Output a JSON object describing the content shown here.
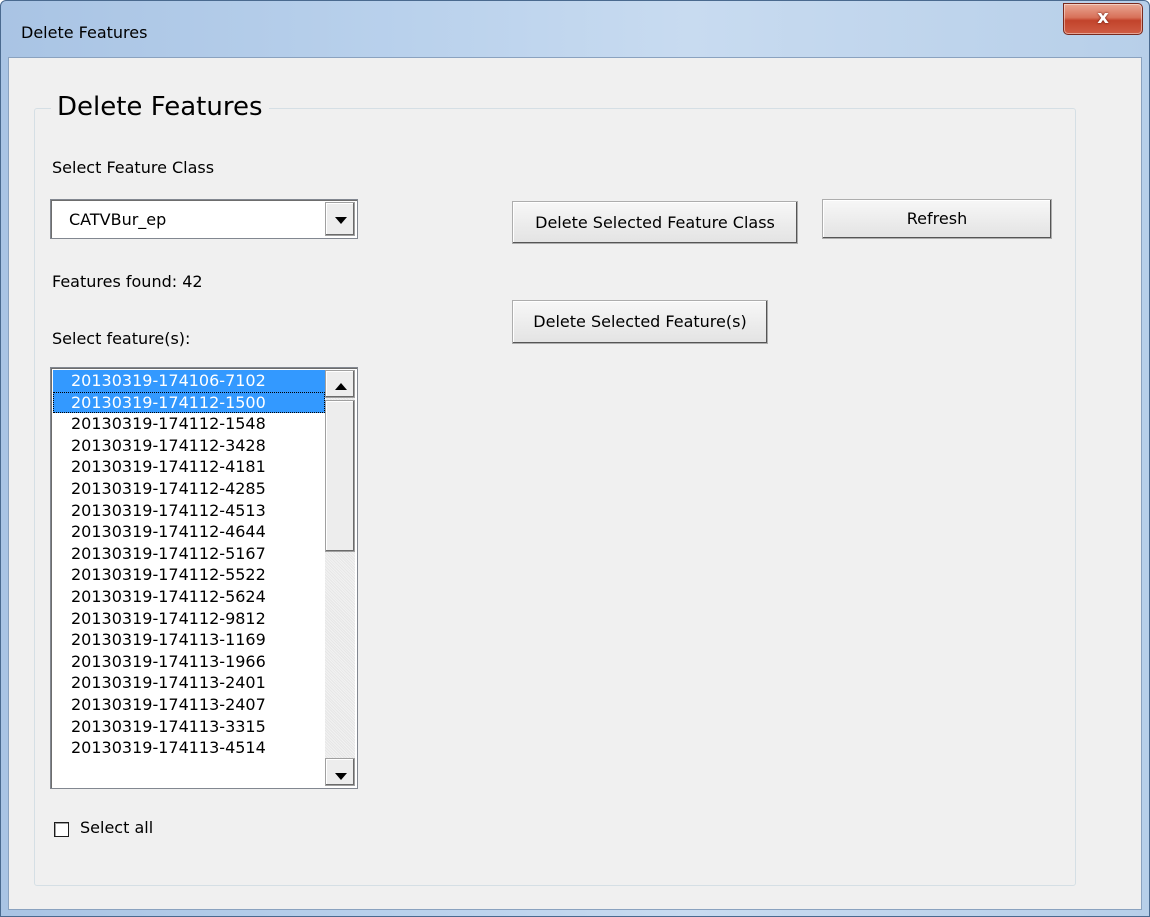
{
  "window": {
    "title": "Delete Features",
    "close_glyph": "x"
  },
  "group": {
    "title": "Delete Features"
  },
  "feature_class": {
    "label": "Select Feature Class",
    "selected": "CATVBur_ep"
  },
  "buttons": {
    "delete_class": "Delete Selected Feature Class",
    "refresh": "Refresh",
    "delete_features": "Delete Selected Feature(s)"
  },
  "features_found": "Features found: 42",
  "features_label": "Select feature(s):",
  "features": [
    {
      "id": "20130319-174106-7102",
      "selected": true
    },
    {
      "id": "20130319-174112-1500",
      "selected": true,
      "focused": true
    },
    {
      "id": "20130319-174112-1548"
    },
    {
      "id": "20130319-174112-3428"
    },
    {
      "id": "20130319-174112-4181"
    },
    {
      "id": "20130319-174112-4285"
    },
    {
      "id": "20130319-174112-4513"
    },
    {
      "id": "20130319-174112-4644"
    },
    {
      "id": "20130319-174112-5167"
    },
    {
      "id": "20130319-174112-5522"
    },
    {
      "id": "20130319-174112-5624"
    },
    {
      "id": "20130319-174112-9812"
    },
    {
      "id": "20130319-174113-1169"
    },
    {
      "id": "20130319-174113-1966"
    },
    {
      "id": "20130319-174113-2401"
    },
    {
      "id": "20130319-174113-2407"
    },
    {
      "id": "20130319-174113-3315"
    },
    {
      "id": "20130319-174113-4514"
    }
  ],
  "select_all": {
    "label": "Select all",
    "checked": false
  },
  "icons": {
    "close": "close-icon",
    "dropdown": "chevron-down-icon",
    "scroll_up": "scroll-up-icon",
    "scroll_down": "scroll-down-icon"
  }
}
